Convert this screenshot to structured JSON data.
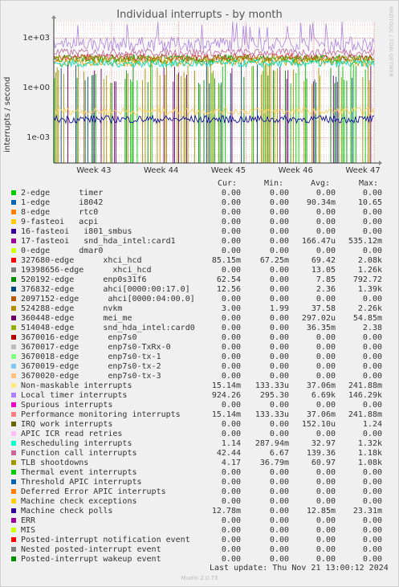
{
  "title": "Individual interrupts - by month",
  "side_text": "RRDTOOL / TOBI OETIKER",
  "ylabel": "interrupts / second",
  "columns": {
    "cur": "Cur:",
    "min": "Min:",
    "avg": "Avg:",
    "max": "Max:"
  },
  "last_update": "Last update: Thu Nov 21 13:00:12 2024",
  "munin_version": "Munin 2.0.73",
  "chart_data": {
    "type": "line",
    "title": "Individual interrupts - by month",
    "ylabel": "interrupts / second",
    "yscale": "log",
    "ylim": [
      3e-05,
      10000
    ],
    "yticks": [
      "1e+03",
      "1e+00",
      "1e-03"
    ],
    "x_ticks": [
      "Week 43",
      "Week 44",
      "Week 45",
      "Week 46",
      "Week 47"
    ],
    "grid": true,
    "series": [
      {
        "name": "Local timer interrupts",
        "color": "#b28ce0",
        "approx_level": 450
      },
      {
        "name": "enp0s31f6",
        "color": "#00a000",
        "approx_level": 60
      },
      {
        "name": "xhci_hcd",
        "color": "#e03030",
        "approx_level": 70
      },
      {
        "name": "nvkm",
        "color": "#c8a000",
        "approx_level": 35
      },
      {
        "name": "TLB shootdowns",
        "color": "#98a000",
        "approx_level": 55
      },
      {
        "name": "Function call interrupts",
        "color": "#c070a0",
        "approx_level": 140
      },
      {
        "name": "Rescheduling interrupts",
        "color": "#00e0c0",
        "approx_level": 30
      },
      {
        "name": "Non-maskable interrupts",
        "color": "#ffd060",
        "approx_level": 0.04
      },
      {
        "name": "Machine check polls",
        "color": "#1010a0",
        "approx_level": 0.013
      }
    ]
  },
  "legend": [
    {
      "label": "2-edge      timer",
      "color": "#00cc00",
      "cur": "0.00",
      "min": "0.00",
      "avg": "0.00",
      "max": "0.00"
    },
    {
      "label": "1-edge      i8042",
      "color": "#0066b3",
      "cur": "0.00",
      "min": "0.00",
      "avg": "90.34m",
      "max": "10.65"
    },
    {
      "label": "8-edge      rtc0",
      "color": "#ff8000",
      "cur": "0.00",
      "min": "0.00",
      "avg": "0.00",
      "max": "0.00"
    },
    {
      "label": "9-fasteoi   acpi",
      "color": "#ffcc00",
      "cur": "0.00",
      "min": "0.00",
      "avg": "0.00",
      "max": "0.00"
    },
    {
      "label": "16-fasteoi   i801_smbus",
      "color": "#330099",
      "cur": "0.00",
      "min": "0.00",
      "avg": "0.00",
      "max": "0.00"
    },
    {
      "label": "17-fasteoi   snd_hda_intel:card1",
      "color": "#990099",
      "cur": "0.00",
      "min": "0.00",
      "avg": "166.47u",
      "max": "535.12m"
    },
    {
      "label": "0-edge      dmar0",
      "color": "#ccff00",
      "cur": "0.00",
      "min": "0.00",
      "avg": "0.00",
      "max": "0.00"
    },
    {
      "label": "327680-edge      xhci_hcd",
      "color": "#ff0000",
      "cur": "85.15m",
      "min": "67.25m",
      "avg": "69.42",
      "max": "2.08k"
    },
    {
      "label": "19398656-edge      xhci_hcd",
      "color": "#808080",
      "cur": "0.00",
      "min": "0.00",
      "avg": "13.05",
      "max": "1.26k"
    },
    {
      "label": "520192-edge      enp0s31f6",
      "color": "#008f00",
      "cur": "62.54",
      "min": "0.00",
      "avg": "7.85",
      "max": "792.72"
    },
    {
      "label": "376832-edge      ahci[0000:00:17.0]",
      "color": "#00487d",
      "cur": "12.56",
      "min": "0.00",
      "avg": "2.36",
      "max": "1.39k"
    },
    {
      "label": "2097152-edge      ahci[0000:04:00.0]",
      "color": "#b35a00",
      "cur": "0.00",
      "min": "0.00",
      "avg": "0.00",
      "max": "0.00"
    },
    {
      "label": "524288-edge      nvkm",
      "color": "#b38f00",
      "cur": "3.00",
      "min": "1.99",
      "avg": "37.58",
      "max": "2.26k"
    },
    {
      "label": "360448-edge      mei_me",
      "color": "#6b006b",
      "cur": "0.00",
      "min": "0.00",
      "avg": "297.02u",
      "max": "54.85m"
    },
    {
      "label": "514048-edge      snd_hda_intel:card0",
      "color": "#8fb300",
      "cur": "0.00",
      "min": "0.00",
      "avg": "36.35m",
      "max": "2.38"
    },
    {
      "label": "3670016-edge      enp7s0",
      "color": "#b30000",
      "cur": "0.00",
      "min": "0.00",
      "avg": "0.00",
      "max": "0.00"
    },
    {
      "label": "3670017-edge      enp7s0-TxRx-0",
      "color": "#bebebe",
      "cur": "0.00",
      "min": "0.00",
      "avg": "0.00",
      "max": "0.00"
    },
    {
      "label": "3670018-edge      enp7s0-tx-1",
      "color": "#80ff80",
      "cur": "0.00",
      "min": "0.00",
      "avg": "0.00",
      "max": "0.00"
    },
    {
      "label": "3670019-edge      enp7s0-tx-2",
      "color": "#80c9ff",
      "cur": "0.00",
      "min": "0.00",
      "avg": "0.00",
      "max": "0.00"
    },
    {
      "label": "3670020-edge      enp7s0-tx-3",
      "color": "#ffc080",
      "cur": "0.00",
      "min": "0.00",
      "avg": "0.00",
      "max": "0.00"
    },
    {
      "label": "Non-maskable interrupts",
      "color": "#ffe680",
      "cur": "15.14m",
      "min": "133.33u",
      "avg": "37.06m",
      "max": "241.88m"
    },
    {
      "label": "Local timer interrupts",
      "color": "#aa80ff",
      "cur": "924.26",
      "min": "295.30",
      "avg": "6.69k",
      "max": "146.29k"
    },
    {
      "label": "Spurious interrupts",
      "color": "#ee00cc",
      "cur": "0.00",
      "min": "0.00",
      "avg": "0.00",
      "max": "0.00"
    },
    {
      "label": "Performance monitoring interrupts",
      "color": "#ff8080",
      "cur": "15.14m",
      "min": "133.33u",
      "avg": "37.06m",
      "max": "241.88m"
    },
    {
      "label": "IRQ work interrupts",
      "color": "#666600",
      "cur": "0.00",
      "min": "0.00",
      "avg": "152.10u",
      "max": "1.24"
    },
    {
      "label": "APIC ICR read retries",
      "color": "#ffbfff",
      "cur": "0.00",
      "min": "0.00",
      "avg": "0.00",
      "max": "0.00"
    },
    {
      "label": "Rescheduling interrupts",
      "color": "#00ffcc",
      "cur": "1.14",
      "min": "287.94m",
      "avg": "32.97",
      "max": "1.32k"
    },
    {
      "label": "Function call interrupts",
      "color": "#cc6699",
      "cur": "42.44",
      "min": "6.67",
      "avg": "139.36",
      "max": "1.18k"
    },
    {
      "label": "TLB shootdowns",
      "color": "#999900",
      "cur": "4.17",
      "min": "36.79m",
      "avg": "60.97",
      "max": "1.08k"
    },
    {
      "label": "Thermal event interrupts",
      "color": "#00cc00",
      "cur": "0.00",
      "min": "0.00",
      "avg": "0.00",
      "max": "0.00"
    },
    {
      "label": "Threshold APIC interrupts",
      "color": "#0066b3",
      "cur": "0.00",
      "min": "0.00",
      "avg": "0.00",
      "max": "0.00"
    },
    {
      "label": "Deferred Error APIC interrupts",
      "color": "#ff8000",
      "cur": "0.00",
      "min": "0.00",
      "avg": "0.00",
      "max": "0.00"
    },
    {
      "label": "Machine check exceptions",
      "color": "#ffcc00",
      "cur": "0.00",
      "min": "0.00",
      "avg": "0.00",
      "max": "0.00"
    },
    {
      "label": "Machine check polls",
      "color": "#330099",
      "cur": "12.78m",
      "min": "0.00",
      "avg": "12.85m",
      "max": "23.31m"
    },
    {
      "label": "ERR",
      "color": "#990099",
      "cur": "0.00",
      "min": "0.00",
      "avg": "0.00",
      "max": "0.00"
    },
    {
      "label": "MIS",
      "color": "#ccff00",
      "cur": "0.00",
      "min": "0.00",
      "avg": "0.00",
      "max": "0.00"
    },
    {
      "label": "Posted-interrupt notification event",
      "color": "#ff0000",
      "cur": "0.00",
      "min": "0.00",
      "avg": "0.00",
      "max": "0.00"
    },
    {
      "label": "Nested posted-interrupt event",
      "color": "#808080",
      "cur": "0.00",
      "min": "0.00",
      "avg": "0.00",
      "max": "0.00"
    },
    {
      "label": "Posted-interrupt wakeup event",
      "color": "#008f00",
      "cur": "0.00",
      "min": "0.00",
      "avg": "0.00",
      "max": "0.00"
    }
  ]
}
